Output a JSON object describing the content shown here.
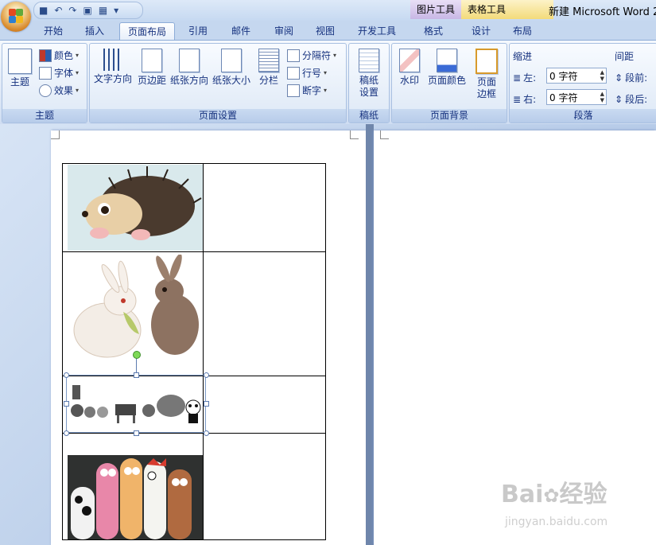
{
  "title_bar": {
    "context_tab_picture": "图片工具",
    "context_tab_table": "表格工具",
    "window_title": "新建 Microsoft Word 2"
  },
  "tabs": [
    "开始",
    "插入",
    "页面布局",
    "引用",
    "邮件",
    "审阅",
    "视图",
    "开发工具",
    "格式",
    "设计",
    "布局"
  ],
  "active_tab": "页面布局",
  "ribbon": {
    "theme": {
      "group": "主题",
      "big": "主题",
      "colors": "颜色",
      "fonts": "字体",
      "effects": "效果"
    },
    "page_setup": {
      "group": "页面设置",
      "text_direction": "文字方向",
      "margins": "页边距",
      "orientation": "纸张方向",
      "size": "纸张大小",
      "columns": "分栏",
      "breaks": "分隔符",
      "line_numbers": "行号",
      "hyphenation": "断字"
    },
    "draft": {
      "group": "稿纸",
      "button_line1": "稿纸",
      "button_line2": "设置"
    },
    "page_background": {
      "group": "页面背景",
      "watermark": "水印",
      "page_color": "页面颜色",
      "page_borders_line1": "页面",
      "page_borders_line2": "边框"
    },
    "paragraph": {
      "group": "段落",
      "indent": "缩进",
      "spacing": "间距",
      "left_label": "左:",
      "right_label": "右:",
      "left_value": "0 字符",
      "right_value": "0 字符",
      "before_label": "段前:",
      "after_label": "段后:"
    }
  },
  "watermark_text": "Bai",
  "watermark_text2": "经验",
  "watermark_url": "jingyan.baidu.com"
}
